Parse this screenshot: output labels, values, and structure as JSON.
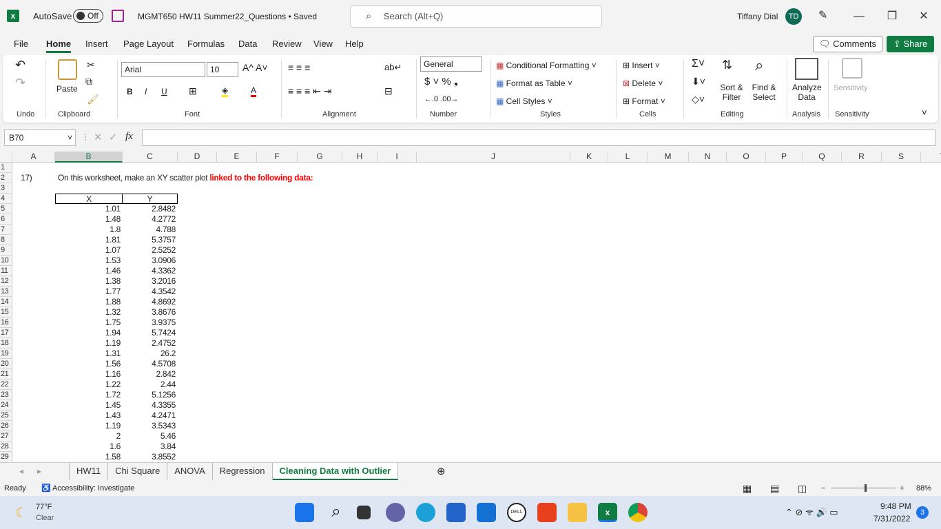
{
  "titlebar": {
    "autosave_label": "AutoSave",
    "autosave_state": "Off",
    "doc_title": "MGMT650 HW11 Summer22_Questions • Saved",
    "search_placeholder": "Search (Alt+Q)",
    "user_name": "Tiffany Dial",
    "user_initials": "TD"
  },
  "menu": {
    "tabs": [
      "File",
      "Home",
      "Insert",
      "Page Layout",
      "Formulas",
      "Data",
      "Review",
      "View",
      "Help"
    ],
    "active": "Home",
    "comments_label": "Comments",
    "share_label": "Share"
  },
  "ribbon": {
    "groups": [
      "Undo",
      "Clipboard",
      "Font",
      "Alignment",
      "Number",
      "Styles",
      "Cells",
      "Editing",
      "Analysis",
      "Sensitivity"
    ],
    "paste_label": "Paste",
    "font_name": "Arial",
    "font_size": "10",
    "number_format": "General",
    "conditional_formatting": "Conditional Formatting",
    "format_as_table": "Format as Table",
    "cell_styles": "Cell Styles",
    "insert": "Insert",
    "delete": "Delete",
    "format": "Format",
    "sort_filter": "Sort & Filter",
    "find_select": "Find & Select",
    "analyze_data": "Analyze Data",
    "sensitivity": "Sensitivity"
  },
  "formula_bar": {
    "name_box": "B70",
    "fx": "fx",
    "value": ""
  },
  "sheet": {
    "columns": [
      "A",
      "B",
      "C",
      "D",
      "E",
      "F",
      "G",
      "H",
      "I",
      "J",
      "K",
      "L",
      "M",
      "N",
      "O",
      "P",
      "Q",
      "R",
      "S",
      "T"
    ],
    "selected_column": "B",
    "question_number": "17)",
    "instruction_plain": "On this worksheet, make an XY scatter plot ",
    "instruction_red": "linked to the following data:",
    "instruction_red_color": "#ff0000",
    "table_headers": [
      "X",
      "Y"
    ],
    "table_rows": [
      [
        "1.01",
        "2.8482"
      ],
      [
        "1.48",
        "4.2772"
      ],
      [
        "1.8",
        "4.788"
      ],
      [
        "1.81",
        "5.3757"
      ],
      [
        "1.07",
        "2.5252"
      ],
      [
        "1.53",
        "3.0906"
      ],
      [
        "1.46",
        "4.3362"
      ],
      [
        "1.38",
        "3.2016"
      ],
      [
        "1.77",
        "4.3542"
      ],
      [
        "1.88",
        "4.8692"
      ],
      [
        "1.32",
        "3.8676"
      ],
      [
        "1.75",
        "3.9375"
      ],
      [
        "1.94",
        "5.7424"
      ],
      [
        "1.19",
        "2.4752"
      ],
      [
        "1.31",
        "26.2"
      ],
      [
        "1.56",
        "4.5708"
      ],
      [
        "1.16",
        "2.842"
      ],
      [
        "1.22",
        "2.44"
      ],
      [
        "1.72",
        "5.1256"
      ],
      [
        "1.45",
        "4.3355"
      ],
      [
        "1.43",
        "4.2471"
      ],
      [
        "1.19",
        "3.5343"
      ],
      [
        "2",
        "5.46"
      ],
      [
        "1.6",
        "3.84"
      ],
      [
        "1.58",
        "3.8552"
      ]
    ]
  },
  "sheet_tabs": {
    "tabs": [
      "HW11",
      "Chi Square",
      "ANOVA",
      "Regression",
      "Cleaning Data with Outlier"
    ],
    "active": "Cleaning Data with Outlier"
  },
  "status": {
    "ready": "Ready",
    "accessibility": "Accessibility: Investigate",
    "zoom": "88%",
    "zoom_level": 88
  },
  "taskbar": {
    "temperature": "77°F",
    "weather": "Clear",
    "time": "9:48 PM",
    "date": "7/31/2022",
    "notifications": "3"
  },
  "colors": {
    "accent": "#107c41"
  }
}
